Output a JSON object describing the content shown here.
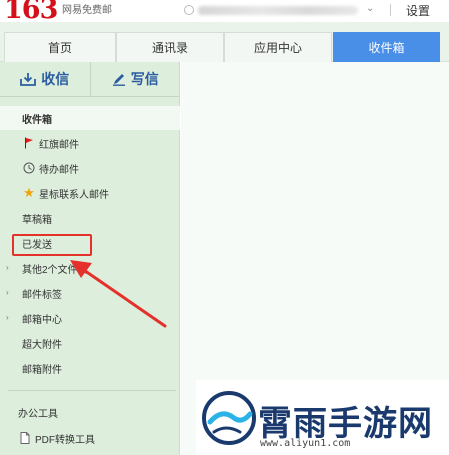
{
  "header": {
    "logo_number": "163",
    "logo_text": "网易免费邮",
    "settings_label": "设置"
  },
  "tabs": [
    {
      "label": "首页",
      "active": false
    },
    {
      "label": "通讯录",
      "active": false
    },
    {
      "label": "应用中心",
      "active": false
    },
    {
      "label": "收件箱",
      "active": true
    }
  ],
  "compose": {
    "receive_label": "收信",
    "write_label": "写信"
  },
  "sidebar": {
    "items": [
      {
        "label": "收件箱",
        "icon": "none",
        "selected": true
      },
      {
        "label": "红旗邮件",
        "icon": "red-flag-icon"
      },
      {
        "label": "待办邮件",
        "icon": "clock-icon"
      },
      {
        "label": "星标联系人邮件",
        "icon": "star-icon"
      },
      {
        "label": "草稿箱",
        "icon": "none"
      },
      {
        "label": "已发送",
        "icon": "none",
        "highlighted": true
      },
      {
        "label": "其他2个文件夹",
        "icon": "expand-arrow-icon"
      },
      {
        "label": "邮件标签",
        "icon": "expand-arrow-icon"
      },
      {
        "label": "邮箱中心",
        "icon": "expand-arrow-icon"
      },
      {
        "label": "超大附件",
        "icon": "none"
      },
      {
        "label": "邮箱附件",
        "icon": "none"
      }
    ],
    "office_tools_label": "办公工具",
    "pdf_tool_label": "PDF转换工具"
  },
  "watermark": {
    "title": "霄雨手游网",
    "url": "www.aliyun1.com"
  },
  "colors": {
    "brand_red": "#d4111b",
    "active_tab": "#4a8fe7",
    "sidebar_bg": "#ddeedd",
    "annotation_red": "#e4312b"
  }
}
